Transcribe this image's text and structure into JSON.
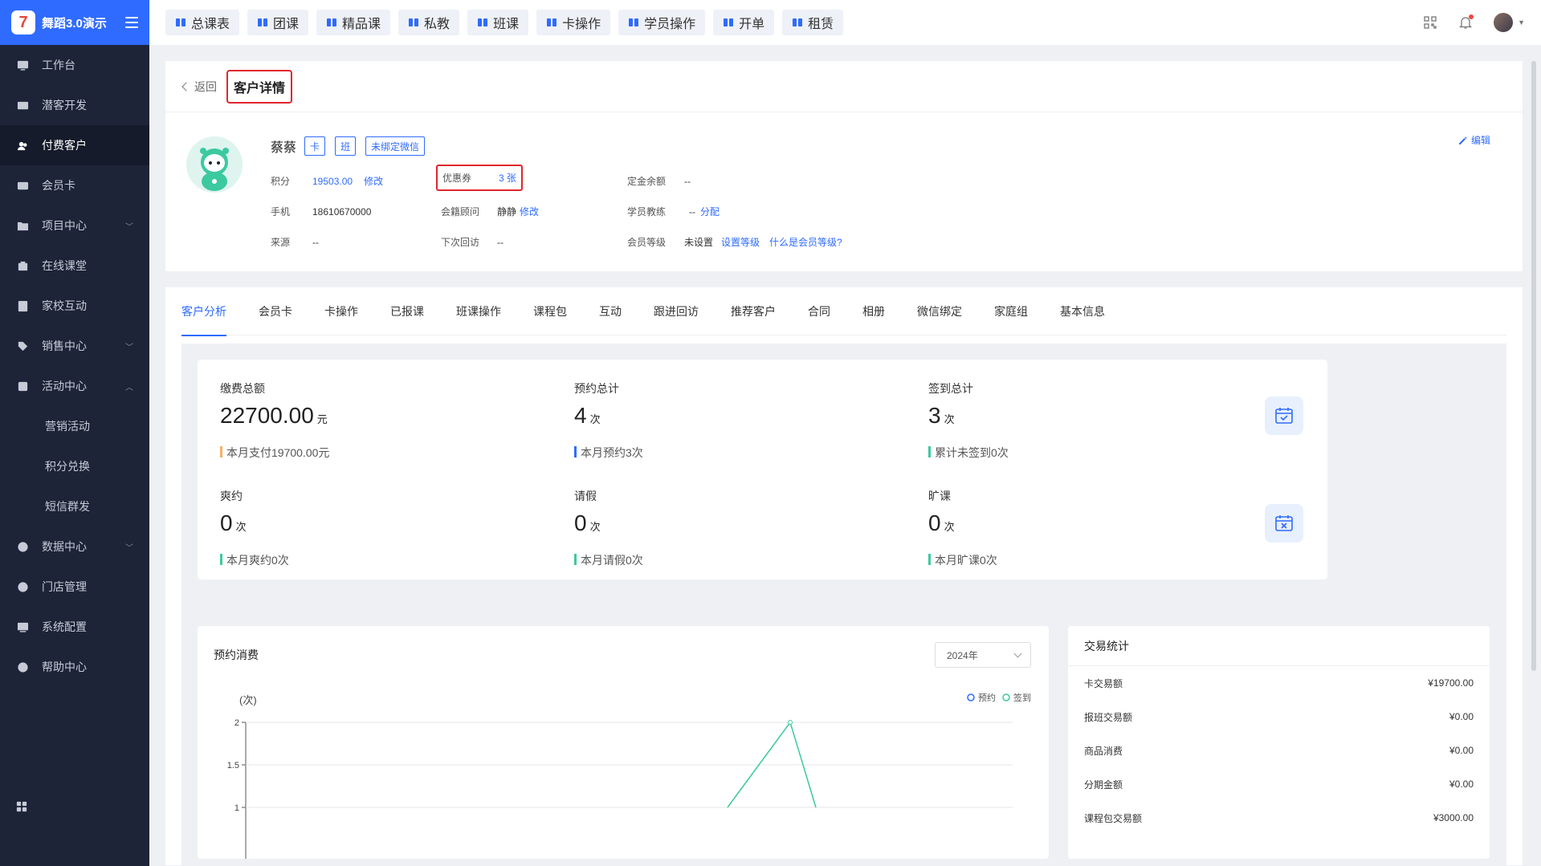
{
  "app": {
    "brand": "舞蹈3.0演示",
    "logo_char": "7"
  },
  "sidebar": {
    "items": [
      {
        "label": "工作台",
        "icon": "monitor-icon"
      },
      {
        "label": "潜客开发",
        "icon": "id-card-icon"
      },
      {
        "label": "付费客户",
        "icon": "users-icon",
        "active": true
      },
      {
        "label": "会员卡",
        "icon": "card-icon"
      },
      {
        "label": "项目中心",
        "icon": "folder-icon",
        "chevron": "down"
      },
      {
        "label": "在线课堂",
        "icon": "camera-icon"
      },
      {
        "label": "家校互动",
        "icon": "contact-book-icon"
      },
      {
        "label": "销售中心",
        "icon": "tag-icon",
        "chevron": "down"
      },
      {
        "label": "活动中心",
        "icon": "activity-icon",
        "chevron": "up"
      },
      {
        "label": "营销活动",
        "sub": true
      },
      {
        "label": "积分兑换",
        "sub": true
      },
      {
        "label": "短信群发",
        "sub": true
      },
      {
        "label": "数据中心",
        "icon": "pie-chart-icon",
        "chevron": "down"
      },
      {
        "label": "门店管理",
        "icon": "store-icon"
      },
      {
        "label": "系统配置",
        "icon": "settings-icon"
      },
      {
        "label": "帮助中心",
        "icon": "help-icon"
      }
    ]
  },
  "topbar": {
    "buttons": [
      "总课表",
      "团课",
      "精品课",
      "私教",
      "班课",
      "卡操作",
      "学员操作",
      "开单",
      "租赁"
    ]
  },
  "detail": {
    "back_label": "返回",
    "title": "客户详情",
    "edit_label": "编辑",
    "customer": {
      "name": "蔡蔡",
      "tags": [
        "卡",
        "班",
        "未绑定微信"
      ],
      "points_label": "积分",
      "points_value": "19503.00",
      "points_action": "修改",
      "coupon_label": "优惠券",
      "coupon_value": "3 张",
      "deposit_label": "定金余额",
      "deposit_value": "--",
      "phone_label": "手机",
      "phone_value": "18610670000",
      "advisor_label": "会籍顾问",
      "advisor_value": "静静",
      "advisor_action": "修改",
      "coach_label": "学员教练",
      "coach_value": "--",
      "coach_action": "分配",
      "source_label": "来源",
      "source_value": "--",
      "next_visit_label": "下次回访",
      "next_visit_value": "--",
      "level_label": "会员等级",
      "level_value": "未设置",
      "level_action": "设置等级",
      "level_help": "什么是会员等级?"
    }
  },
  "tabs": [
    "客户分析",
    "会员卡",
    "卡操作",
    "已报课",
    "班课操作",
    "课程包",
    "互动",
    "跟进回访",
    "推荐客户",
    "合同",
    "相册",
    "微信绑定",
    "家庭组",
    "基本信息"
  ],
  "stats": [
    {
      "title": "缴费总额",
      "value": "22700.00",
      "unit": "元",
      "foot": "本月支付19700.00元",
      "accent": "#f5b164",
      "icon": "yuan-icon"
    },
    {
      "title": "预约总计",
      "value": "4",
      "unit": "次",
      "foot": "本月预约3次",
      "accent": "#2f6bff",
      "icon": "calendar-clock-icon"
    },
    {
      "title": "签到总计",
      "value": "3",
      "unit": "次",
      "foot": "累计未签到0次",
      "accent": "#3cc9a0",
      "icon": "calendar-check-icon"
    },
    {
      "title": "爽约",
      "value": "0",
      "unit": "次",
      "foot": "本月爽约0次",
      "accent": "#3cc9a0",
      "icon": "document-cancel-icon"
    },
    {
      "title": "请假",
      "value": "0",
      "unit": "次",
      "foot": "本月请假0次",
      "accent": "#3cc9a0",
      "icon": "person-leave-icon"
    },
    {
      "title": "旷课",
      "value": "0",
      "unit": "次",
      "foot": "本月旷课0次",
      "accent": "#3cc9a0",
      "icon": "calendar-x-icon"
    }
  ],
  "chart": {
    "title": "预约消费",
    "year": "2024年",
    "unit_label": "(次)",
    "legend": [
      "预约",
      "签到"
    ],
    "colors": {
      "booking": "#2f6bff",
      "checkin": "#3cc9a0"
    }
  },
  "chart_data": {
    "type": "line",
    "ylabel": "(次)",
    "ylim": [
      1,
      2
    ],
    "y_ticks": [
      "2",
      "1.5",
      "1"
    ],
    "series": [
      {
        "name": "签到",
        "points": [
          {
            "y": 1
          },
          {
            "y": 2
          },
          {
            "y": 1
          }
        ]
      }
    ]
  },
  "trade": {
    "title": "交易统计",
    "rows": [
      {
        "label": "卡交易额",
        "value": "¥19700.00"
      },
      {
        "label": "报班交易额",
        "value": "¥0.00"
      },
      {
        "label": "商品消费",
        "value": "¥0.00"
      },
      {
        "label": "分期金额",
        "value": "¥0.00"
      },
      {
        "label": "课程包交易额",
        "value": "¥3000.00"
      }
    ]
  }
}
